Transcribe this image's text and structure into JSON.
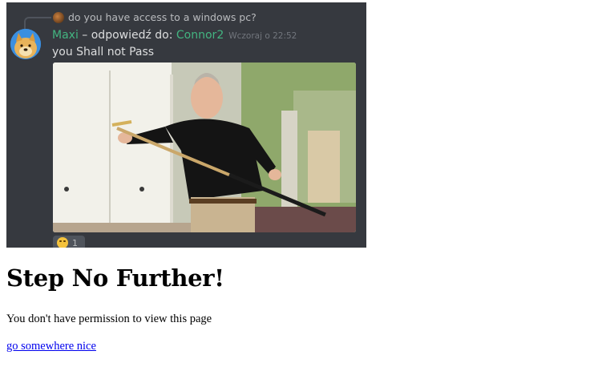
{
  "discord_screenshot": {
    "reply_preview": "do you have access to a windows pc?",
    "author": "Maxi",
    "reply_separator": " – odpowiedź do: ",
    "replied_to_user": "Connor2",
    "timestamp": "Wczoraj o 22:52",
    "message": "you Shall not Pass",
    "reaction_count": "1",
    "colors": {
      "background": "#36393f",
      "username": "#43b581",
      "text": "#dcddde",
      "muted": "#72767d"
    },
    "icons": {
      "reply_avatar": "reply-avatar-icon",
      "avatar": "doge-avatar-icon",
      "reaction": "grinning-face-emoji-icon"
    }
  },
  "page": {
    "title": "Step No Further!",
    "message": "You don't have permission to view this page",
    "link_text": "go somewhere nice",
    "colors": {
      "link": "#0000ee",
      "text": "#000000"
    }
  }
}
